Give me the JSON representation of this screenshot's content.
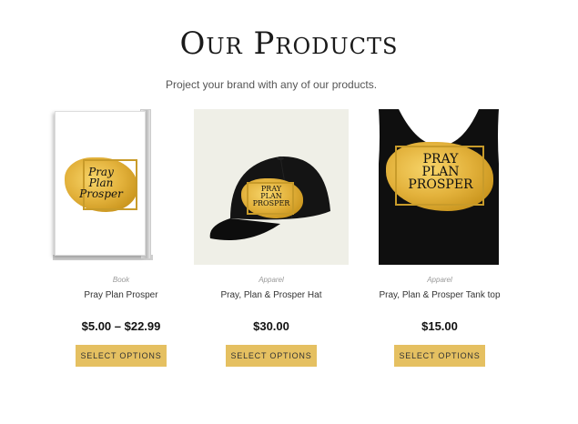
{
  "header": {
    "title": "Our Products",
    "subtitle": "Project your brand with any of our products."
  },
  "products": [
    {
      "category": "Book",
      "name": "Pray Plan Prosper",
      "price": "$5.00 – $22.99",
      "button_label": "Select options",
      "image_icon": "book-icon",
      "artwork_text": [
        "Pray",
        "Plan",
        "Prosper"
      ]
    },
    {
      "category": "Apparel",
      "name": "Pray, Plan & Prosper Hat",
      "price": "$30.00",
      "button_label": "Select options",
      "image_icon": "hat-icon",
      "artwork_text": [
        "PRAY",
        "PLAN",
        "PROSPER"
      ]
    },
    {
      "category": "Apparel",
      "name": "Pray, Plan & Prosper Tank top",
      "price": "$15.00",
      "button_label": "Select options",
      "image_icon": "tank-top-icon",
      "artwork_text": [
        "PRAY",
        "PLAN",
        "PROSPER"
      ]
    }
  ],
  "colors": {
    "button_bg": "#e5c061",
    "gold": "#d9a92d",
    "hat_bg": "#efefe7",
    "garment": "#111111"
  }
}
